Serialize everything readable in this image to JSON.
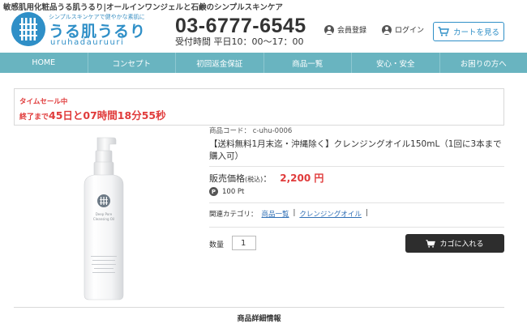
{
  "header": {
    "tagline": "敏感肌用化粧品うる肌うるり|オールインワンジェルと石鹸のシンプルスキンケア",
    "logo": {
      "tag": "シンプルスキンケアで健やかな素肌に",
      "name": "うる肌うるり",
      "romaji": "uruhadauruuri"
    },
    "phone": "03-6777-6545",
    "hours": "受付時間 平日10：00～17：00",
    "member_label": "会員登録",
    "login_label": "ログイン",
    "cart_label": "カートを見る"
  },
  "nav": {
    "items": [
      "HOME",
      "コンセプト",
      "初回返金保証",
      "商品一覧",
      "安心・安全",
      "お困りの方へ"
    ]
  },
  "sale": {
    "label": "タイムセール中",
    "prefix": "終了まで",
    "countdown": "45日と07時間18分55秒"
  },
  "product": {
    "code": "商品コード： c-uhu-0006",
    "name": "【送料無料1月末迄・沖縄除く】クレンジングオイル150mL（1回に3本まで購入可）",
    "price_label": "販売価格",
    "tax_label": "(税込)",
    "price_colon": "：",
    "price": "2,200 円",
    "points": "100 Pt",
    "points_icon": "P",
    "category_label": "関連カテゴリ：",
    "categories": [
      "商品一覧",
      "クレンジングオイル"
    ],
    "category_sep": "|",
    "bottle_text": "Deep Pore Cleansing Oil",
    "quantity_label": "数量",
    "quantity_value": "1",
    "add_to_cart_label": "カゴに入れる"
  },
  "details": {
    "title": "商品詳細情報"
  },
  "colors": {
    "brand_blue": "#2f8fc7",
    "nav_teal": "#69b4c0",
    "sale_red": "#e03b3b",
    "button_dark": "#2d2d2d"
  }
}
